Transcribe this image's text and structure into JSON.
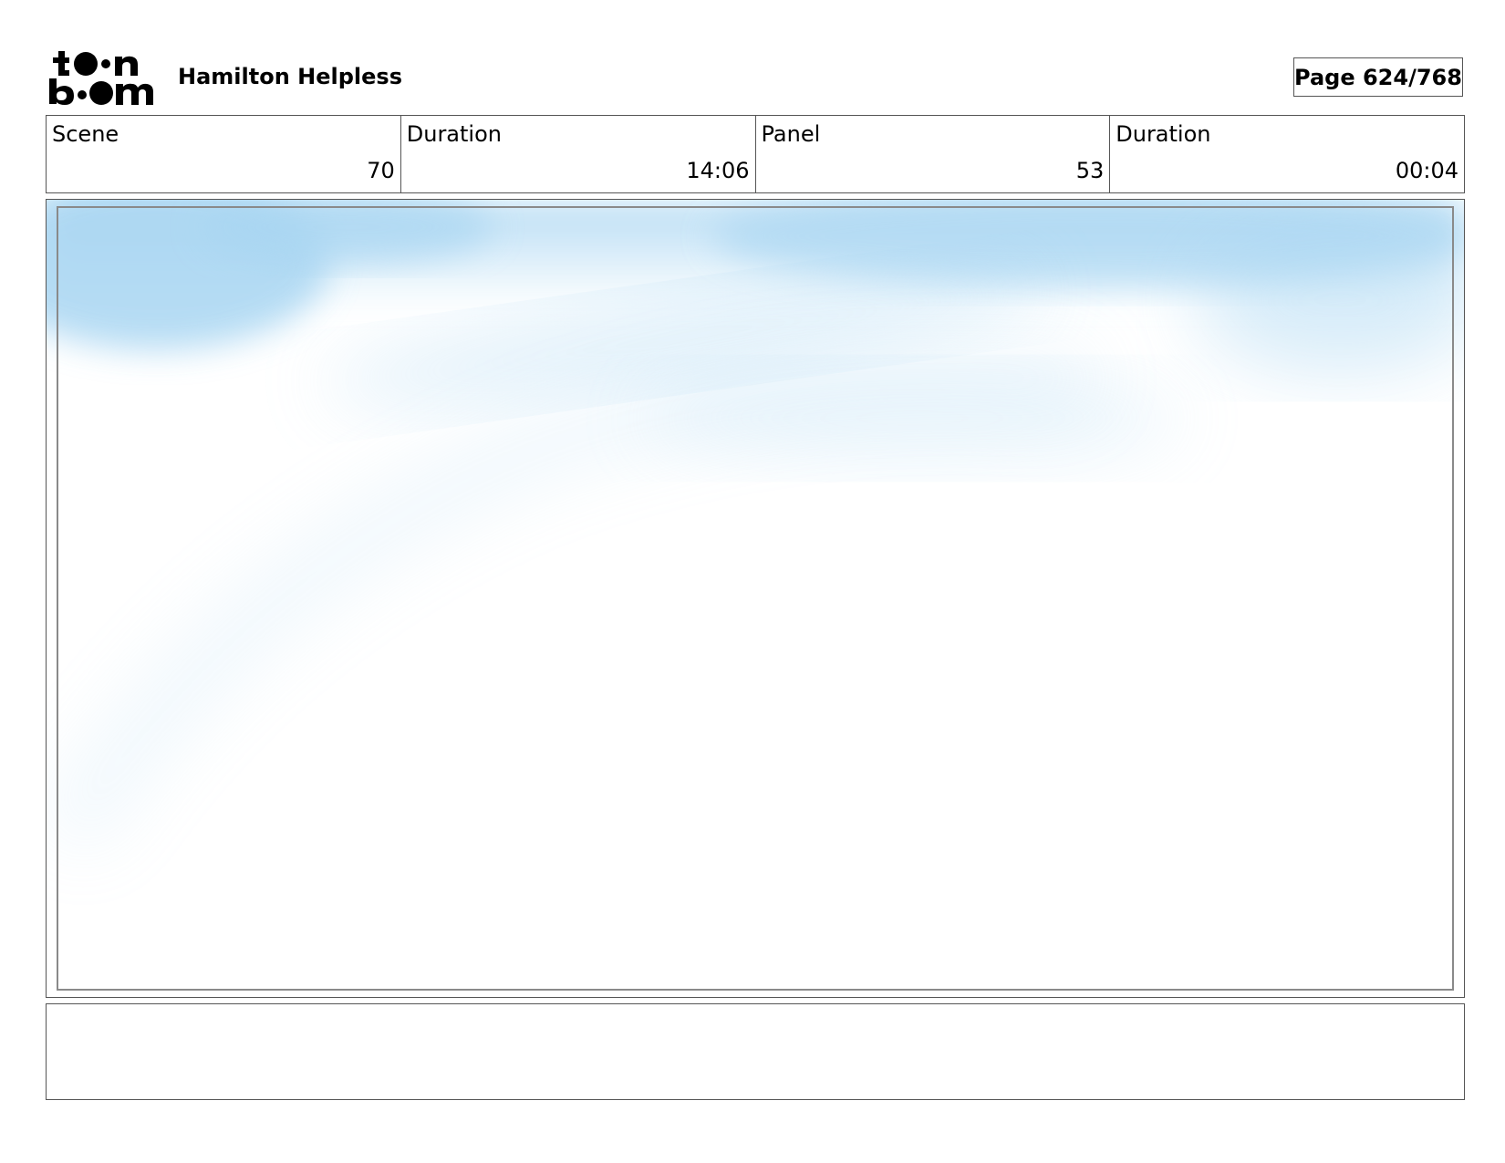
{
  "header": {
    "logo_text": "toon boom",
    "project_title": "Hamilton Helpless",
    "page_label": "Page 624/768"
  },
  "info": [
    {
      "label": "Scene",
      "value": "70"
    },
    {
      "label": "Duration",
      "value": "14:06"
    },
    {
      "label": "Panel",
      "value": "53"
    },
    {
      "label": "Duration",
      "value": "00:04"
    }
  ],
  "panel": {
    "sky_color": "#a9d6f2",
    "background_color": "#ffffff",
    "frame_color": "#8a8a8a"
  },
  "notes": {
    "text": ""
  }
}
